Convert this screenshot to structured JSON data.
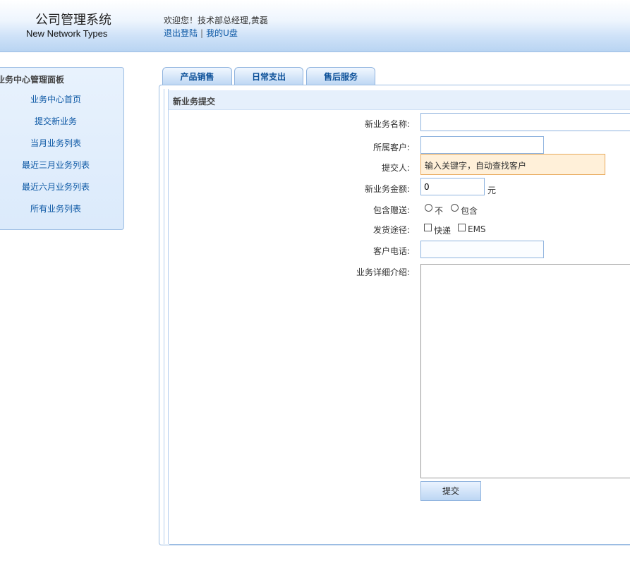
{
  "header": {
    "logo_cn": "公司管理系统",
    "logo_en": "New Network Types",
    "welcome": "欢迎您！技术部总经理,黄磊",
    "logout": "退出登陆",
    "separator": "|",
    "my_disk": "我的U盘"
  },
  "sidebar": {
    "title": "业务中心管理面板",
    "items": [
      {
        "label": "业务中心首页"
      },
      {
        "label": "提交新业务"
      },
      {
        "label": "当月业务列表"
      },
      {
        "label": "最近三月业务列表"
      },
      {
        "label": "最近六月业务列表"
      },
      {
        "label": "所有业务列表"
      }
    ]
  },
  "tabs": [
    {
      "label": "产品销售"
    },
    {
      "label": "日常支出"
    },
    {
      "label": "售后服务"
    }
  ],
  "panel": {
    "title": "新业务提交"
  },
  "form": {
    "business_name_label": "新业务名称:",
    "business_name_value": "",
    "customer_label": "所属客户:",
    "customer_value": "",
    "submitter_label": "提交人:",
    "autocomplete_hint": "输入关键字，自动查找客户",
    "amount_label": "新业务金额:",
    "amount_value": "0",
    "amount_unit": "元",
    "gift_label": "包含赠送:",
    "gift_options": [
      "不",
      "包含"
    ],
    "ship_label": "发货途径:",
    "ship_options": [
      "快递",
      "EMS"
    ],
    "phone_label": "客户电话:",
    "phone_value": "",
    "detail_label": "业务详细介绍:",
    "detail_value": "",
    "submit_label": "提交"
  },
  "colors": {
    "link": "#0b57a4",
    "header_gradient_end": "#b9d4f2",
    "border": "#9cbde3",
    "autocomplete_bg": "#fff0d9"
  }
}
